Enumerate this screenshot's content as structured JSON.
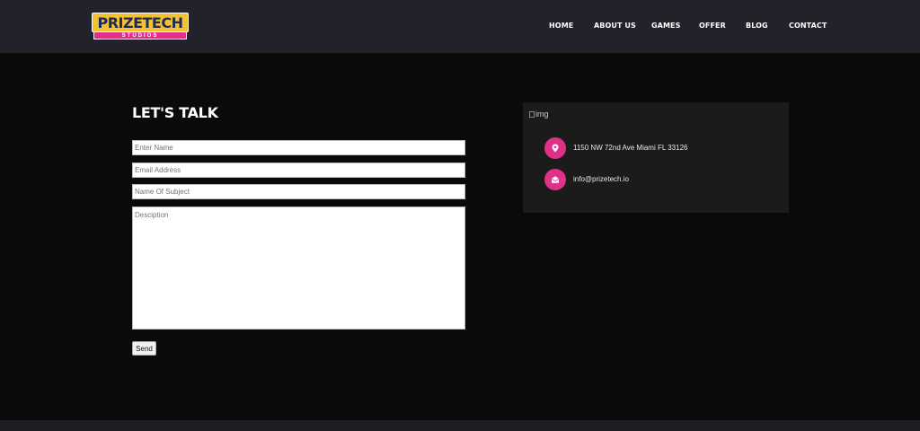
{
  "brand": {
    "name": "PRIZETECH",
    "subtitle": "STUDIOS",
    "colors": {
      "yellow": "#f2c233",
      "navy": "#1e2a57",
      "pink": "#e0318a"
    }
  },
  "nav": {
    "items": [
      {
        "label": "HOME"
      },
      {
        "label": "ABOUT US"
      },
      {
        "label": "GAMES"
      },
      {
        "label": "OFFER"
      },
      {
        "label": "BLOG"
      },
      {
        "label": "CONTACT"
      }
    ]
  },
  "contact_form": {
    "title": "LET'S TALK",
    "name_placeholder": "Enter Name",
    "email_placeholder": "Email Address",
    "subject_placeholder": "Name Of Subject",
    "description_placeholder": "Desciption",
    "send_label": "Send"
  },
  "info_card": {
    "image_alt": "img",
    "address": "1150 NW 72nd Ave Miami FL 33126",
    "email": "info@prizetech.io",
    "icons": [
      "location-pin-icon",
      "envelope-icon"
    ]
  }
}
